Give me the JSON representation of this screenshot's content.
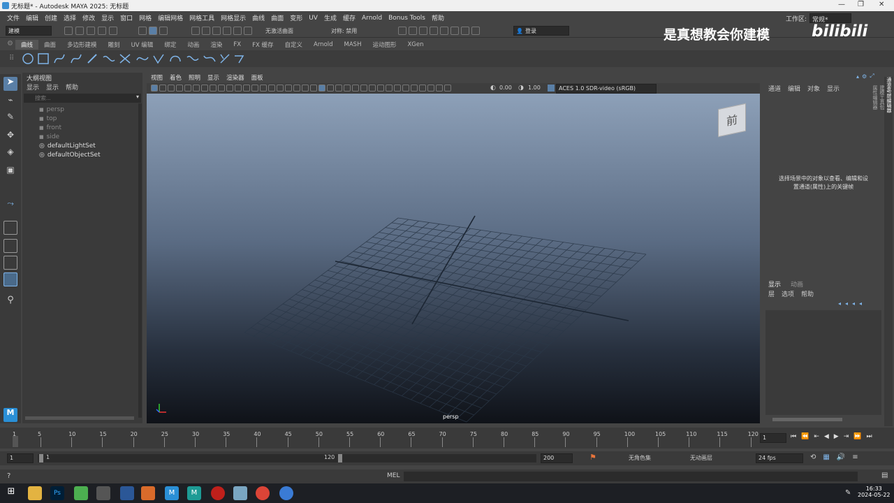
{
  "window": {
    "title": "无标题* - Autodesk MAYA 2025: 无标题",
    "workspace_label": "工作区:",
    "workspace_value": "常规*"
  },
  "menu": [
    "文件",
    "编辑",
    "创建",
    "选择",
    "修改",
    "显示",
    "窗口",
    "网格",
    "编辑网格",
    "网格工具",
    "网格显示",
    "曲线",
    "曲面",
    "变形",
    "UV",
    "生成",
    "缓存",
    "Arnold",
    "Bonus Tools",
    "帮助"
  ],
  "statusline": {
    "mode": "建模",
    "live_surface": "无激活曲面",
    "symmetry": "对称: 禁用",
    "login": "登录"
  },
  "watermark": {
    "text": "是真想教会你建模",
    "logo": "bilibili"
  },
  "shelf_tabs": [
    "曲线",
    "曲面",
    "多边形建模",
    "雕刻",
    "UV 编辑",
    "绑定",
    "动画",
    "渲染",
    "FX",
    "FX 缓存",
    "自定义",
    "Arnold",
    "MASH",
    "运动图形",
    "XGen"
  ],
  "outliner": {
    "title": "大纲视图",
    "menu": [
      "显示",
      "显示",
      "帮助"
    ],
    "search_placeholder": "搜索...",
    "items": [
      "persp",
      "top",
      "front",
      "side",
      "defaultLightSet",
      "defaultObjectSet"
    ]
  },
  "viewport": {
    "menu": [
      "视图",
      "着色",
      "照明",
      "显示",
      "渲染器",
      "面板"
    ],
    "exposure": "0.00",
    "gamma": "1.00",
    "colorspace": "ACES 1.0 SDR-video (sRGB)",
    "camera": "persp",
    "viewcube": "前"
  },
  "channel_box": {
    "menu": [
      "通道",
      "编辑",
      "对象",
      "显示"
    ],
    "hint_line1": "选择场景中的对象以查看、编辑和设",
    "hint_line2": "置通道(属性)上的关键帧",
    "side_tabs": [
      "通道盒/层编辑器",
      "建模工具包",
      "属性编辑器"
    ]
  },
  "layer_editor": {
    "tabs": [
      "显示",
      "动画"
    ],
    "menu": [
      "层",
      "选项",
      "帮助"
    ]
  },
  "time_slider": {
    "ticks": [
      "1",
      "5",
      "10",
      "15",
      "20",
      "25",
      "30",
      "35",
      "40",
      "45",
      "50",
      "55",
      "60",
      "65",
      "70",
      "75",
      "80",
      "85",
      "90",
      "95",
      "100",
      "105",
      "110",
      "115",
      "120"
    ],
    "current": "1"
  },
  "range_slider": {
    "start": "1",
    "range_start": "1",
    "range_end": "120",
    "end": "200",
    "char_set": "无角色集",
    "anim_layer": "无动画层",
    "fps": "24 fps"
  },
  "command_line": {
    "label": "MEL"
  },
  "taskbar": {
    "time": "16:33",
    "date": "2024-05-22"
  }
}
